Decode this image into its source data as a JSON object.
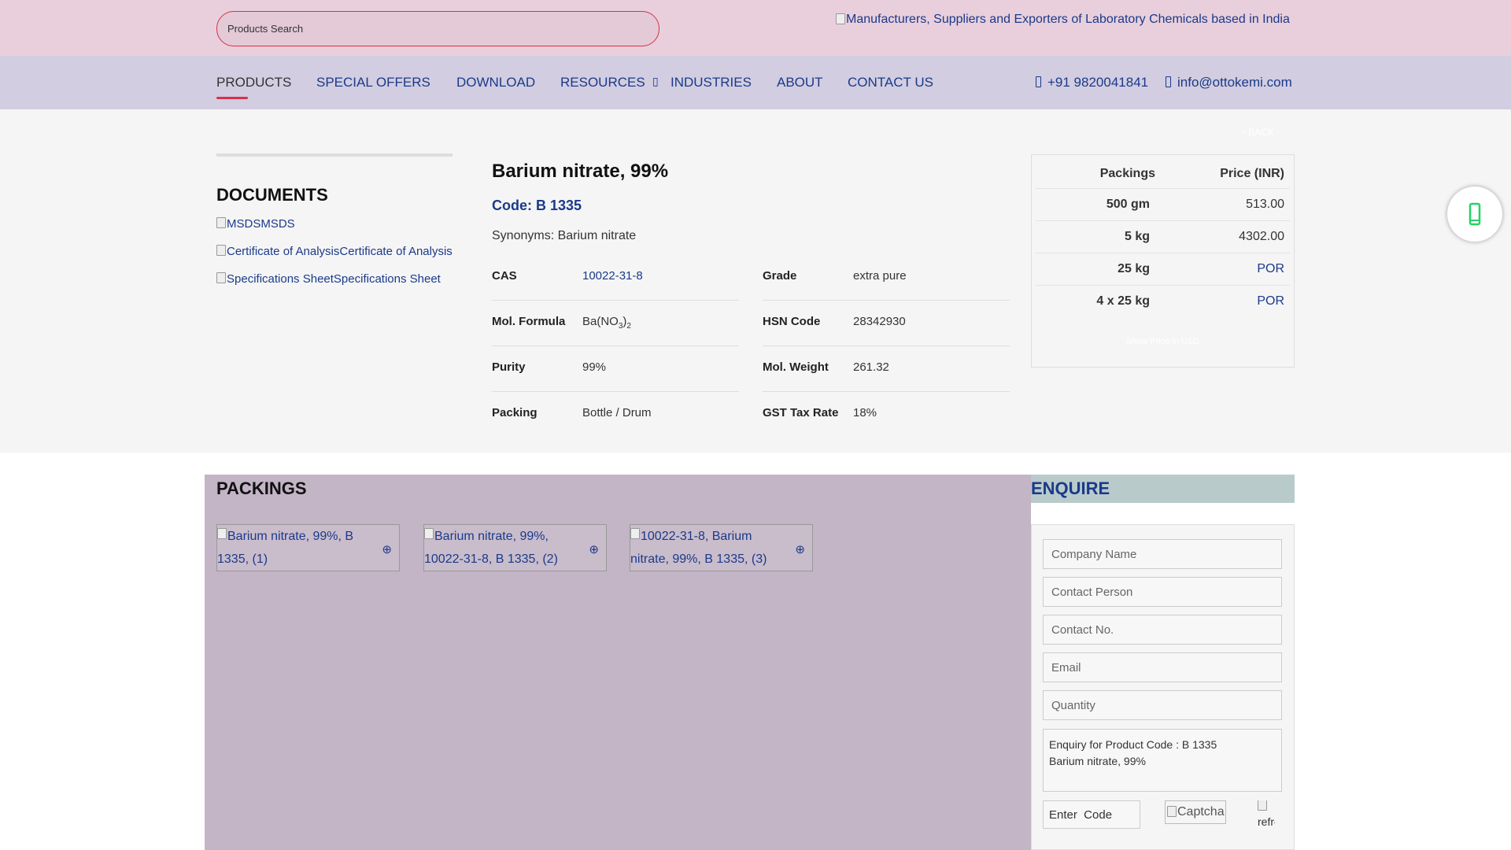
{
  "search": {
    "placeholder": "Products Search"
  },
  "logo": {
    "alt": "Manufacturers, Suppliers and Exporters of Laboratory Chemicals based in India"
  },
  "nav": {
    "items": [
      {
        "label": "PRODUCTS",
        "active": true
      },
      {
        "label": "SPECIAL OFFERS"
      },
      {
        "label": "DOWNLOAD"
      },
      {
        "label": "RESOURCES"
      },
      {
        "label": "INDUSTRIES"
      },
      {
        "label": "ABOUT"
      },
      {
        "label": "CONTACT US"
      }
    ],
    "phone": "+91 9820041841",
    "email": "info@ottokemi.com"
  },
  "back_label": "BACK",
  "documents": {
    "title": "DOCUMENTS",
    "items": [
      {
        "alt": "MSDS",
        "label": "MSDS"
      },
      {
        "alt": "Certificate of Analysis",
        "label": "Certificate of Analysis"
      },
      {
        "alt": "Specifications Sheet",
        "label": "Specifications Sheet"
      }
    ]
  },
  "product": {
    "title": "Barium nitrate, 99%",
    "code": "Code: B 1335",
    "synonyms": "Synonyms: Barium nitrate",
    "specs_left": [
      {
        "label": "CAS",
        "value": "10022-31-8"
      },
      {
        "label": "Mol. Formula",
        "value_main": "Ba(NO",
        "value_sub1": "3",
        "value_mid": ")",
        "value_sub2": "2"
      },
      {
        "label": "Purity",
        "value": "99%"
      },
      {
        "label": "Packing",
        "value": "Bottle / Drum"
      }
    ],
    "specs_right": [
      {
        "label": "Grade",
        "value": "extra pure"
      },
      {
        "label": "HSN Code",
        "value": "28342930"
      },
      {
        "label": "Mol. Weight",
        "value": "261.32"
      },
      {
        "label": "GST Tax Rate",
        "value": "18%"
      }
    ]
  },
  "prices": {
    "col_packings": "Packings",
    "col_price": "Price (INR)",
    "rows": [
      {
        "pack": "500 gm",
        "price": "513.00"
      },
      {
        "pack": "5 kg",
        "price": "4302.00"
      },
      {
        "pack": "25 kg",
        "price": "POR"
      },
      {
        "pack": "4 x 25 kg",
        "price": "POR"
      }
    ],
    "usd_link": "Show Price in USD"
  },
  "packings": {
    "title": "PACKINGS",
    "thumbs": [
      {
        "alt": "Barium nitrate, 99%, B 1335, (1)"
      },
      {
        "alt": "Barium nitrate, 99%, 10022-31-8, B 1335, (2)"
      },
      {
        "alt": "10022-31-8, Barium nitrate, 99%, B 1335, (3)"
      }
    ]
  },
  "enquire": {
    "title": "ENQUIRE",
    "company_placeholder": "Company Name",
    "contact_placeholder": "Contact Person",
    "phone_placeholder": "Contact No.",
    "email_placeholder": "Email",
    "quantity_placeholder": "Quantity",
    "message_value": "Enquiry for Product Code : B 1335\nBarium nitrate, 99%",
    "code_placeholder": "Enter  Code",
    "captcha_alt": "Captcha",
    "refresh_alt": "refresh"
  },
  "colors": {
    "topbar_bg": "#e9cfdc",
    "navbar_bg": "#d2cde0",
    "link_blue": "#1a3a8a",
    "accent_red": "#d9304a",
    "whatsapp_green": "#25d366"
  }
}
